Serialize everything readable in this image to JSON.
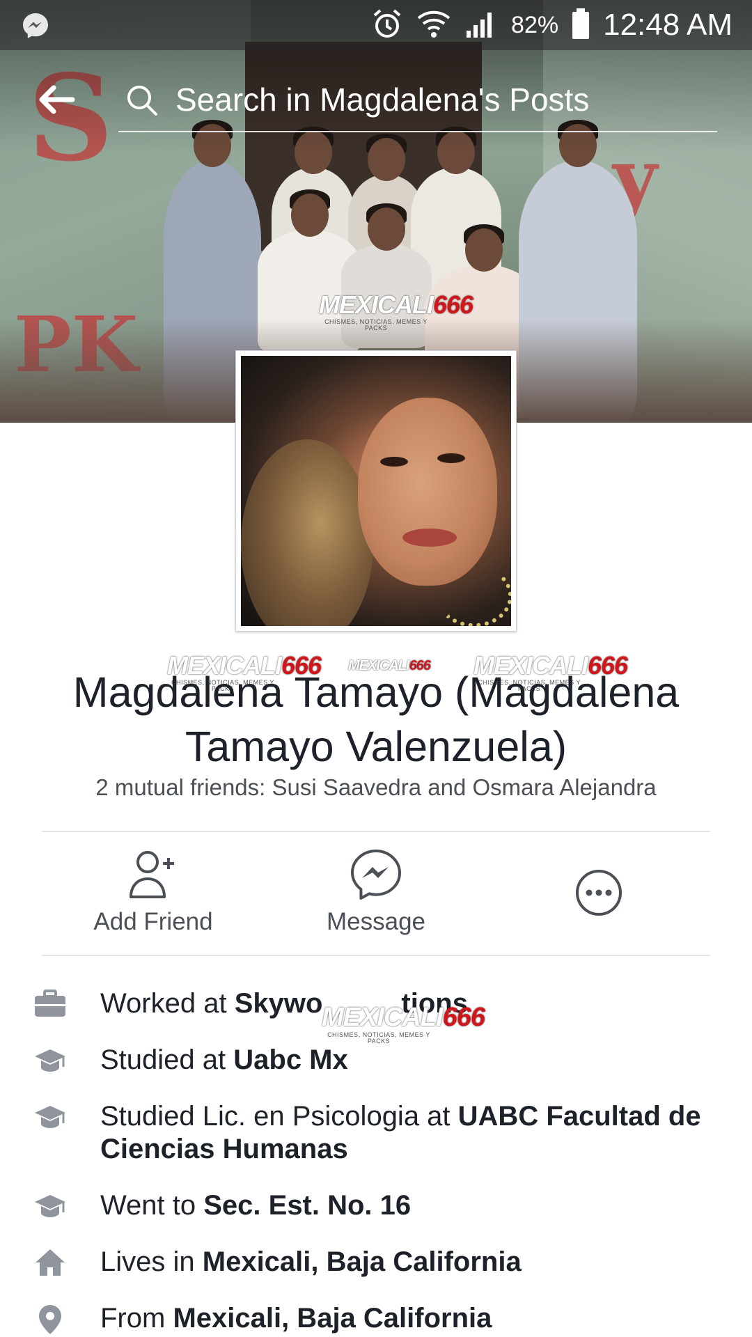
{
  "status_bar": {
    "battery": "82%",
    "time": "12:48 AM"
  },
  "search": {
    "placeholder": "Search in Magdalena's Posts"
  },
  "watermark": {
    "brand_prefix": "MEXICALI",
    "brand_suffix": "666",
    "tagline": "CHISMES, NOTICIAS, MEMES Y PACKS"
  },
  "profile": {
    "name": "Magdalena Tamayo (Magdalena Tamayo Valenzuela)",
    "mutual_friends": "2 mutual friends: Susi Saavedra and Osmara Alejandra"
  },
  "actions": {
    "add_friend": "Add Friend",
    "message": "Message"
  },
  "about": [
    {
      "icon": "briefcase-icon",
      "prefix": "Worked at ",
      "value": "Skywo",
      "value_tail": "tions"
    },
    {
      "icon": "graduation-cap-icon",
      "prefix": "Studied at ",
      "value": "Uabc Mx"
    },
    {
      "icon": "graduation-cap-icon",
      "prefix": "Studied Lic. en Psicologia at ",
      "value": "UABC Facultad de Ciencias Humanas"
    },
    {
      "icon": "graduation-cap-icon",
      "prefix": "Went to ",
      "value": "Sec. Est. No. 16"
    },
    {
      "icon": "home-icon",
      "prefix": "Lives in ",
      "value": "Mexicali, Baja California"
    },
    {
      "icon": "location-pin-icon",
      "prefix": "From ",
      "value": "Mexicali, Baja California"
    }
  ],
  "colors": {
    "text_primary": "#1d2129",
    "text_secondary": "#4b4f56",
    "icon_gray": "#90949c",
    "watermark_red": "#d0161b"
  }
}
